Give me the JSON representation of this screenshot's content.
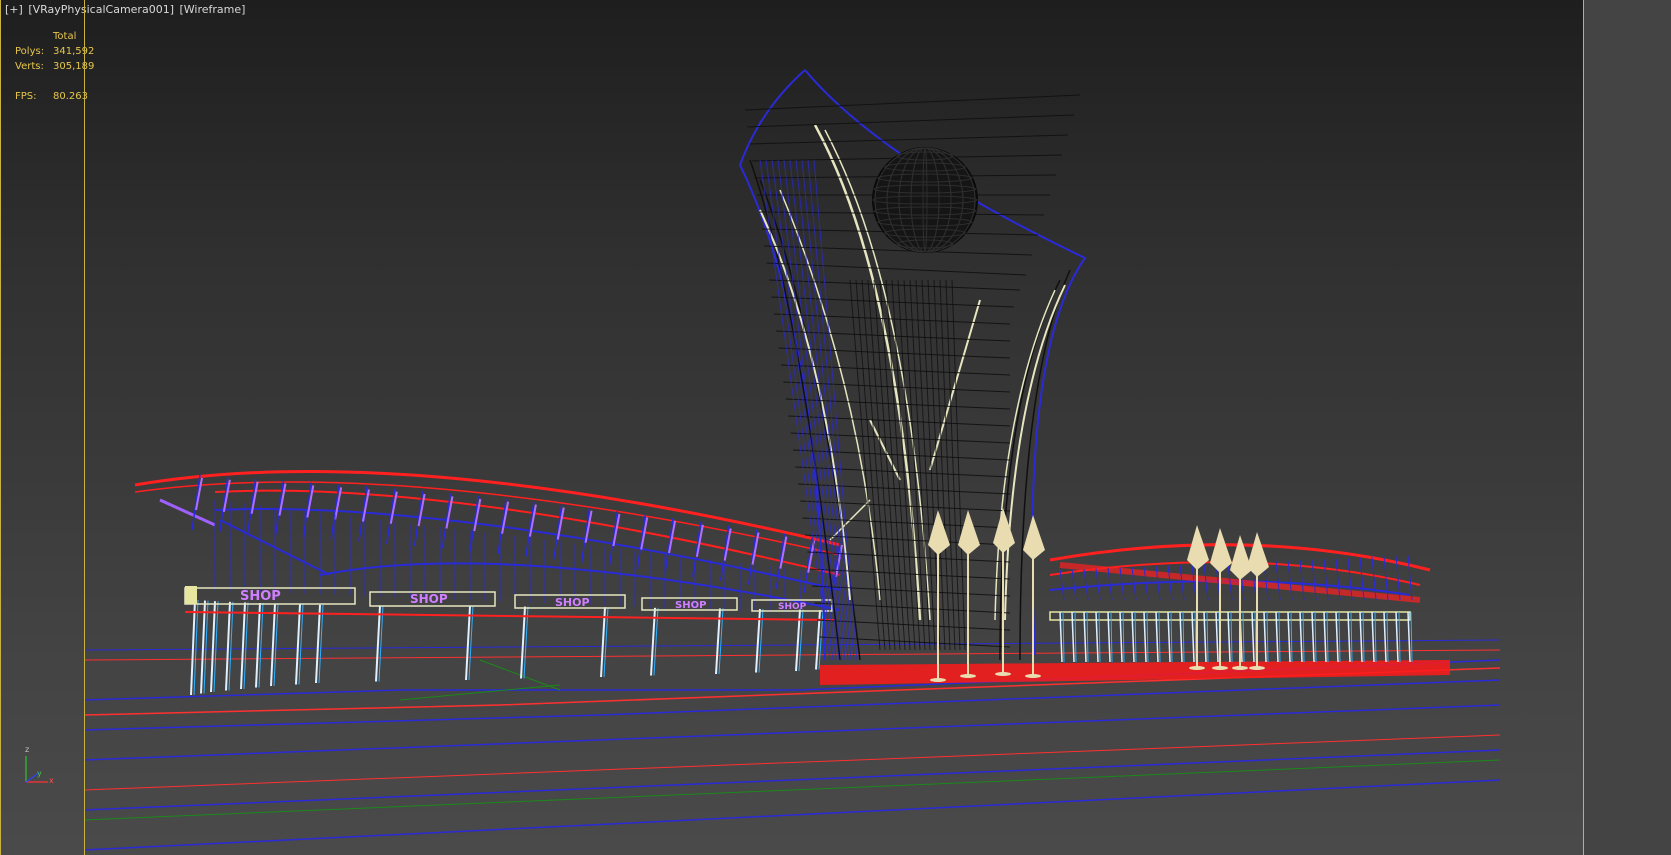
{
  "viewport": {
    "label": {
      "plus": "[+]",
      "camera": "[VRayPhysicalCamera001]",
      "mode": "[Wireframe]"
    },
    "stats": {
      "header": "Total",
      "polys_label": "Polys:",
      "polys_value": "341,592",
      "verts_label": "Verts:",
      "verts_value": "305,189",
      "fps_label": "FPS:",
      "fps_value": "80.263"
    },
    "axis": {
      "z": "z",
      "x": "x",
      "y": "y"
    },
    "signs": [
      "SHOP",
      "SHOP",
      "SHOP",
      "SHOP",
      "SHOP"
    ]
  },
  "colors": {
    "frame_highlight": "#c9b33f",
    "stats_text": "#e6c64c",
    "wire_blue": "#2a2ad8",
    "wire_red": "#ff2020",
    "wire_white": "#e6e6c0",
    "wire_black": "#101010"
  }
}
